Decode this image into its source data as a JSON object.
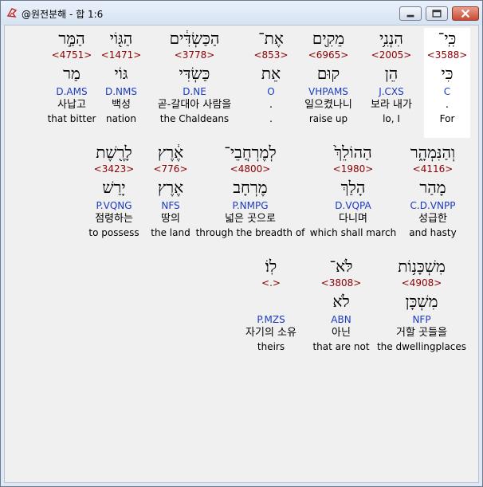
{
  "window": {
    "title": "@원전분해 - 합 1:6"
  },
  "verse": [
    {
      "heb": "כִּֽי־",
      "num": "<3588>",
      "root": "כִּי",
      "parse": "C",
      "kor": "",
      "eng": "For",
      "dot": "."
    },
    {
      "heb": "הִנְנִ֥י",
      "num": "<2005>",
      "root": "הֵן",
      "parse": "J.CXS",
      "kor": "보라 내가",
      "eng": "lo, I"
    },
    {
      "heb": "מֵקִ֖ים",
      "num": "<6965>",
      "root": "קוּם",
      "parse": "VHPAMS",
      "kor": "일으켰나니",
      "eng": "raise up"
    },
    {
      "heb": "אֶת־",
      "num": "<853>",
      "root": "אֵת",
      "parse": "O",
      "kor": ".",
      "eng": "."
    },
    {
      "heb": "הַכַּשְׂדִּ֔ים",
      "num": "<3778>",
      "root": "כַּשְׂדִּי",
      "parse": "D.NE",
      "kor": "곧-갈대아 사람을",
      "eng": "the Chaldeans"
    },
    {
      "heb": "הַגּ֖וֹי",
      "num": "<1471>",
      "root": "גּוֹי",
      "parse": "D.NMS",
      "kor": "백성",
      "eng": "nation"
    },
    {
      "heb": "הַמַּ֣ר",
      "num": "<4751>",
      "root": "מַר",
      "parse": "D.AMS",
      "kor": "사납고",
      "eng": "that bitter"
    },
    {
      "heb": "וְהַנִּמְהָ֑ר",
      "num": "<4116>",
      "root": "מָהַר",
      "parse": "C.D.VNPP",
      "kor": "성급한",
      "eng": "and hasty"
    },
    {
      "heb": "הַהוֹלֵךְ֙",
      "num": "<1980>",
      "root": "הָלַךְ",
      "parse": "D.VQPA",
      "kor": "다니며",
      "eng": "which shall march"
    },
    {
      "heb": "לְמֶרְחֲבֵי־",
      "num": "<4800>",
      "root": "מֶרְחָב",
      "parse": "P.NMPG",
      "kor": "넓은 곳으로",
      "eng": "through the breadth of"
    },
    {
      "heb": "אֶ֔רֶץ",
      "num": "<776>",
      "root": "אֶרֶץ",
      "parse": "NFS",
      "kor": "땅의",
      "eng": "the land"
    },
    {
      "heb": "לָרֶ֖שֶׁת",
      "num": "<3423>",
      "root": "יָרַשׁ",
      "parse": "P.VQNG",
      "kor": "점령하는",
      "eng": "to possess"
    },
    {
      "heb": "מִשְׁכָּנ֥וֹת",
      "num": "<4908>",
      "root": "מִשְׁכָּן",
      "parse": "NFP",
      "kor": "거할 곳들을",
      "eng": "the dwellingplaces"
    },
    {
      "heb": "לֹּא־",
      "num": "<3808>",
      "root": "לֹא",
      "parse": "ABN",
      "kor": "아닌",
      "eng": "that are not"
    },
    {
      "heb": "לֽוֹ׃",
      "num": "<.>",
      "root": "",
      "parse": "P.MZS",
      "kor": "자기의 소유",
      "eng": "theirs"
    }
  ]
}
